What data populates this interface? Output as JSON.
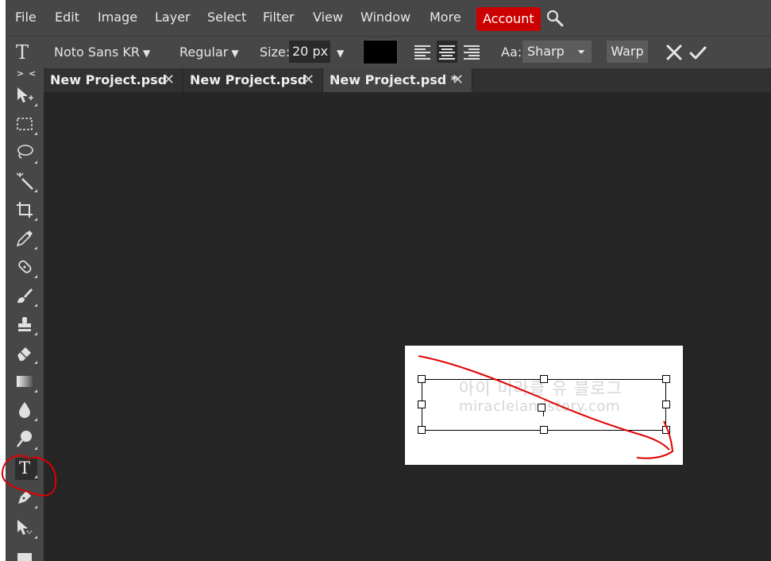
{
  "menu": {
    "items": [
      "File",
      "Edit",
      "Image",
      "Layer",
      "Select",
      "Filter",
      "View",
      "Window",
      "More"
    ],
    "account_label": "Account",
    "account_color": "#cc0000"
  },
  "options": {
    "tool_glyph": "T",
    "font_family": "Noto Sans KR",
    "font_style": "Regular",
    "size_label": "Size:",
    "size_value": "20 px",
    "text_color": "#000000",
    "antialias_label": "Aa:",
    "antialias_value": "Sharp",
    "warp_label": "Warp"
  },
  "tabs": [
    {
      "label": "New Project.psd",
      "close": "✕"
    },
    {
      "label": "New Project.psd",
      "close": "✕"
    },
    {
      "label": "New Project.psd *",
      "close": "✕"
    }
  ],
  "toolbar": {
    "collapse_label": "> <",
    "tools": [
      "move-icon",
      "marquee-icon",
      "lasso-icon",
      "magic-wand-icon",
      "crop-icon",
      "eyedropper-icon",
      "healing-brush-icon",
      "brush-icon",
      "clone-stamp-icon",
      "eraser-icon",
      "gradient-icon",
      "blur-icon",
      "dodge-icon",
      "type-icon",
      "pen-icon",
      "path-select-icon",
      "shape-icon"
    ],
    "active_tool": "type-icon"
  },
  "canvas": {
    "watermark_line1": "아이 미라클 유 블로그",
    "watermark_line2": "miracleiandstory.com",
    "annotation_color": "#e00000"
  }
}
